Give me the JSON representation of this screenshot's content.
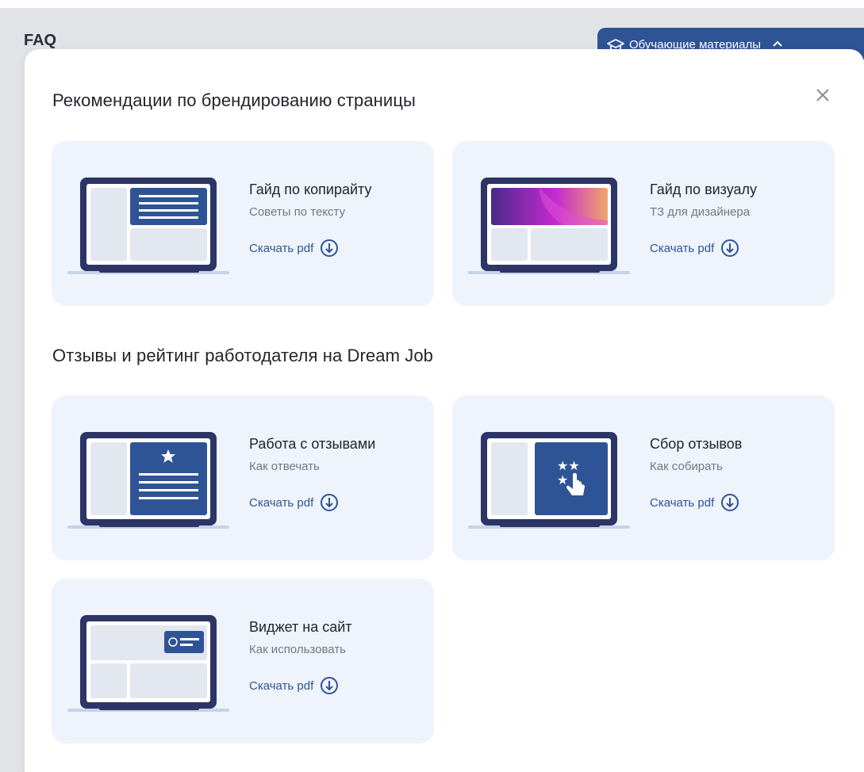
{
  "header": {
    "faq_label": "FAQ",
    "materials_label": "Обучающие материалы",
    "materials_icon": "graduation-cap-icon"
  },
  "modal": {
    "close_icon": "close-icon",
    "sections": [
      {
        "title": "Рекомендации по брендированию страницы",
        "cards": [
          {
            "title": "Гайд по копирайту",
            "subtitle": "Советы по тексту",
            "download": "Скачать pdf",
            "illustration": "laptop-text-document"
          },
          {
            "title": "Гайд по визуалу",
            "subtitle": "ТЗ для дизайнера",
            "download": "Скачать pdf",
            "illustration": "laptop-gradient-banner"
          }
        ]
      },
      {
        "title": "Отзывы и рейтинг работодателя на Dream Job",
        "cards": [
          {
            "title": "Работа с отзывами",
            "subtitle": "Как отвечать",
            "download": "Скачать pdf",
            "illustration": "laptop-star-review"
          },
          {
            "title": "Сбор отзывов",
            "subtitle": "Как собирать",
            "download": "Скачать pdf",
            "illustration": "laptop-stars-pointer"
          },
          {
            "title": "Виджет на сайт",
            "subtitle": "Как использовать",
            "download": "Скачать pdf",
            "illustration": "laptop-widget"
          }
        ]
      }
    ]
  },
  "colors": {
    "accent": "#2f5496",
    "laptop_frame": "#2d3566",
    "card_bg": "#eef3fc",
    "panel": "#e3e7f0",
    "backdrop": "#e2e3e7"
  }
}
